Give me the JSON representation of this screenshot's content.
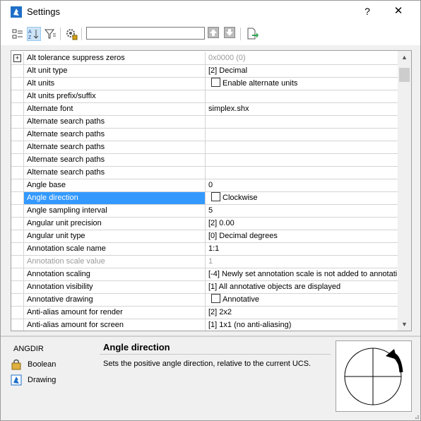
{
  "window": {
    "title": "Settings",
    "help_label": "?",
    "close_label": "✕"
  },
  "toolbar": {
    "buttons": [
      {
        "icon": "categorized-view-icon"
      },
      {
        "icon": "alphabetical-sort-icon"
      },
      {
        "icon": "filter-icon"
      },
      {
        "icon": "settings-gear-icon"
      }
    ],
    "search_value": "",
    "prev_icon": "arrow-up-icon",
    "next_icon": "arrow-down-icon",
    "export_icon": "export-icon"
  },
  "grid": {
    "rows": [
      {
        "name": "Alt tolerance suppress zeros",
        "value": "0x0000 (0)",
        "disabled_value": true,
        "expander": "+"
      },
      {
        "name": "Alt unit type",
        "value": "[2] Decimal"
      },
      {
        "name": "Alt units",
        "value": "Enable alternate units",
        "checkbox": true
      },
      {
        "name": "Alt units prefix/suffix",
        "value": ""
      },
      {
        "name": "Alternate font",
        "value": "simplex.shx"
      },
      {
        "name": "Alternate search paths",
        "value": ""
      },
      {
        "name": "Alternate search paths",
        "value": ""
      },
      {
        "name": "Alternate search paths",
        "value": ""
      },
      {
        "name": "Alternate search paths",
        "value": ""
      },
      {
        "name": "Alternate search paths",
        "value": ""
      },
      {
        "name": "Angle base",
        "value": "0"
      },
      {
        "name": "Angle direction",
        "value": "Clockwise",
        "checkbox": true,
        "selected": true
      },
      {
        "name": "Angle sampling interval",
        "value": "5"
      },
      {
        "name": "Angular unit precision",
        "value": "[2] 0.00"
      },
      {
        "name": "Angular unit type",
        "value": "[0] Decimal degrees"
      },
      {
        "name": "Annotation scale name",
        "value": "1:1"
      },
      {
        "name": "Annotation scale value",
        "value": "1",
        "disabled": true
      },
      {
        "name": "Annotation scaling",
        "value": "[-4] Newly set annotation scale is not added to annotati"
      },
      {
        "name": "Annotation visibility",
        "value": "[1] All annotative objects are displayed"
      },
      {
        "name": "Annotative drawing",
        "value": "Annotative",
        "checkbox": true
      },
      {
        "name": "Anti-alias amount for render",
        "value": "[2] 2x2"
      },
      {
        "name": "Anti-alias amount for screen",
        "value": "[1] 1x1 (no anti-aliasing)"
      }
    ],
    "scroll_up": "▲",
    "scroll_down": "▼"
  },
  "details": {
    "variable_name": "ANGDIR",
    "type_label": "Boolean",
    "category_label": "Drawing",
    "title": "Angle direction",
    "description": "Sets the positive angle direction, relative to the current UCS."
  },
  "colors": {
    "selection": "#3399ff",
    "accent": "#0078d7"
  }
}
